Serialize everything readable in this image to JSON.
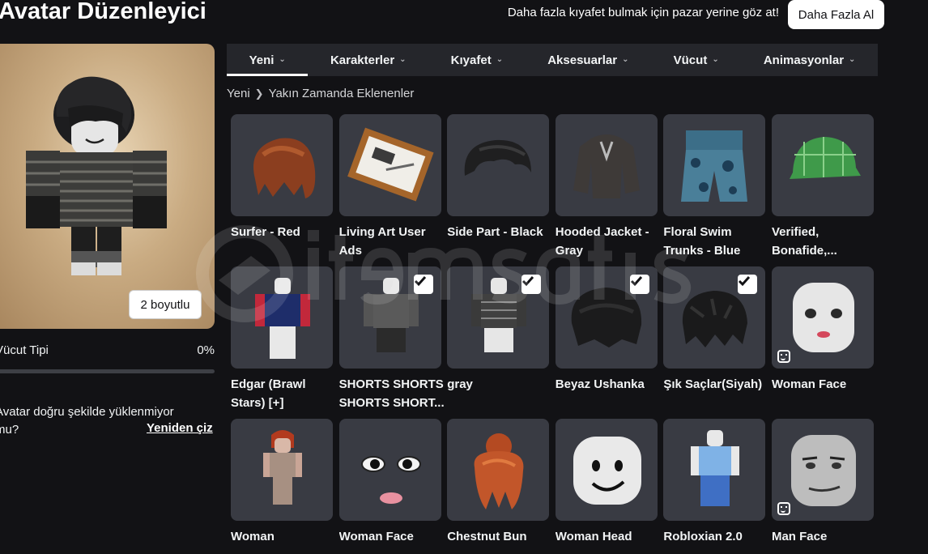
{
  "header": {
    "title": "Avatar Düzenleyici",
    "promo_text": "Daha fazla kıyafet bulmak için pazar yerine göz at!",
    "more_button": "Daha Fazla Al"
  },
  "avatar_panel": {
    "dimension_button": "2 boyutlu",
    "body_type_label": "Vücut Tipi",
    "body_type_value": "0%",
    "body_type_level": 0,
    "warning_text": "Avatar doğru şekilde yüklenmiyor mu?",
    "redraw_link": "Yeniden çiz"
  },
  "tabs": [
    {
      "label": "Yeni",
      "active": true
    },
    {
      "label": "Karakterler",
      "active": false
    },
    {
      "label": "Kıyafet",
      "active": false
    },
    {
      "label": "Aksesuarlar",
      "active": false
    },
    {
      "label": "Vücut",
      "active": false
    },
    {
      "label": "Animasyonlar",
      "active": false
    }
  ],
  "breadcrumb": {
    "root": "Yeni",
    "current": "Yakın Zamanda Eklenenler"
  },
  "items": [
    {
      "name": "Surfer - Red",
      "kind": "hair-red",
      "checked": false,
      "face": false
    },
    {
      "name": "Living Art User Ads",
      "kind": "frame",
      "checked": false,
      "face": false
    },
    {
      "name": "Side Part - Black",
      "kind": "hair-black",
      "checked": false,
      "face": false
    },
    {
      "name": "Hooded Jacket - Gray",
      "kind": "jacket",
      "checked": false,
      "face": false
    },
    {
      "name": "Floral Swim Trunks - Blue",
      "kind": "trunks",
      "checked": false,
      "face": false
    },
    {
      "name": "Verified, Bonafide,...",
      "kind": "cap",
      "checked": false,
      "face": false
    },
    {
      "name": "Edgar (Brawl Stars) [+]",
      "kind": "char-edgar",
      "checked": false,
      "face": false
    },
    {
      "name": "SHORTS SHORTS SHORTS SHORT...",
      "kind": "char-shorts",
      "checked": true,
      "face": false
    },
    {
      "name": "gray",
      "kind": "char-gray",
      "checked": true,
      "face": false
    },
    {
      "name": "Beyaz Ushanka",
      "kind": "hat-black",
      "checked": true,
      "face": false
    },
    {
      "name": "Şık Saçlar(Siyah)",
      "kind": "hair-messy",
      "checked": true,
      "face": false
    },
    {
      "name": "Woman Face",
      "kind": "head-woman",
      "checked": false,
      "face": true
    },
    {
      "name": "Woman",
      "kind": "char-woman",
      "checked": false,
      "face": false
    },
    {
      "name": "Woman Face",
      "kind": "face-woman",
      "checked": false,
      "face": false
    },
    {
      "name": "Chestnut Bun",
      "kind": "hair-bun",
      "checked": false,
      "face": false
    },
    {
      "name": "Woman Head",
      "kind": "head-plain",
      "checked": false,
      "face": false
    },
    {
      "name": "Robloxian 2.0",
      "kind": "char-robloxian",
      "checked": false,
      "face": false
    },
    {
      "name": "Man Face",
      "kind": "head-man",
      "checked": false,
      "face": true
    }
  ],
  "watermark": {
    "brand": "itemsatış",
    "tagline": "HESAP ASKIN / ITEM / E-PIN",
    "suffix": ".com"
  },
  "colors": {
    "background": "#121215",
    "card": "#393b43",
    "tab_bar": "#25262b",
    "accent": "#ffffff"
  }
}
